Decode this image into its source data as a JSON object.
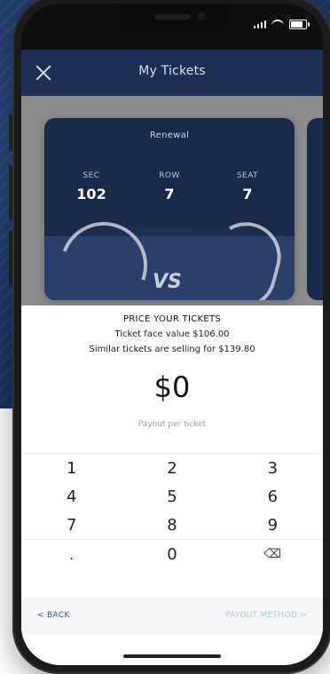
{
  "screen": {
    "title": "My Tickets",
    "ticket": {
      "tag": "Renewal",
      "section_label": "SEC",
      "section_value": "102",
      "row_label": "ROW",
      "row_value": "7",
      "seat_label": "SEAT",
      "seat_value": "7",
      "art_text": "VS"
    },
    "price_sheet": {
      "heading": "PRICE YOUR TICKETS",
      "face_value": "Ticket face value $106.00",
      "similar": "Similar tickets are selling for $139.80",
      "amount": "$0",
      "payout_label": "Payout per ticket"
    },
    "keypad": [
      [
        "1",
        "2",
        "3"
      ],
      [
        "4",
        "5",
        "6"
      ],
      [
        "7",
        "8",
        "9"
      ],
      [
        ".",
        "0",
        "⌫"
      ]
    ],
    "footer": {
      "back": "< BACK",
      "payout_method": "PAYOUT METHOD >"
    }
  },
  "icons": {
    "close": "close-icon",
    "signal": "signal-icon",
    "wifi": "wifi-icon",
    "battery": "battery-icon",
    "backspace": "backspace-icon"
  },
  "colors": {
    "backdrop_blue": "#1f3b6b",
    "topbar_blue": "#1e2f55",
    "ticket_blue": "#18294a",
    "sheet_white": "#ffffff",
    "link_blue": "#2d5bb3",
    "disabled_blue": "#b4c3e1"
  }
}
